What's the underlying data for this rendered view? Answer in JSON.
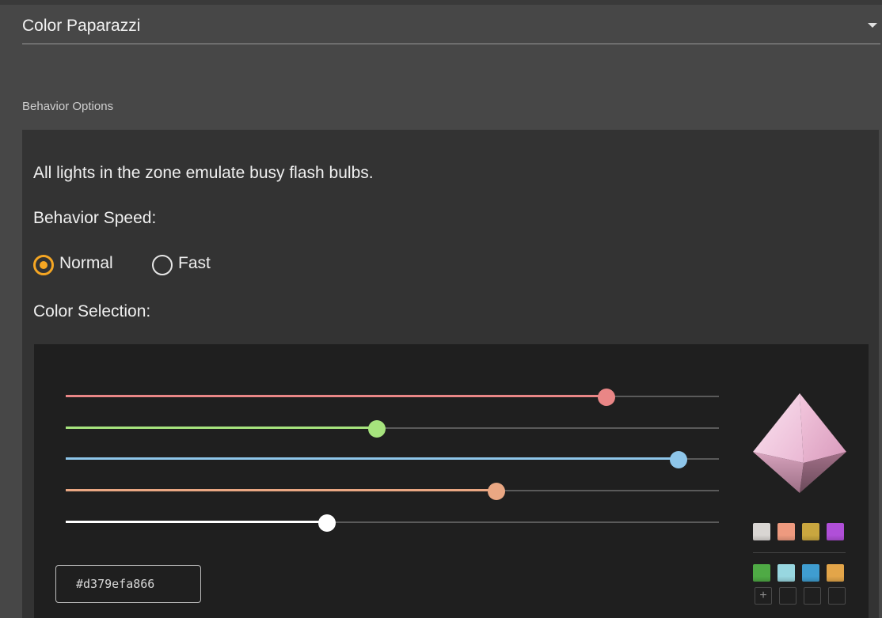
{
  "dropdown": {
    "value": "Color Paparazzi"
  },
  "section": {
    "label": "Behavior Options"
  },
  "panel": {
    "description": "All lights in the zone emulate busy flash bulbs.",
    "speed_label": "Behavior Speed:",
    "speed_options": [
      {
        "label": "Normal",
        "checked": true
      },
      {
        "label": "Fast",
        "checked": false
      }
    ],
    "color_label": "Color Selection:"
  },
  "picker": {
    "sliders": [
      {
        "name": "red",
        "fraction": 0.828,
        "fill_color": "#e98686",
        "thumb_color": "#e98686"
      },
      {
        "name": "green",
        "fraction": 0.476,
        "fill_color": "#a6e37d",
        "thumb_color": "#a6e37d"
      },
      {
        "name": "blue",
        "fraction": 0.938,
        "fill_color": "#8ec6ea",
        "thumb_color": "#8ec6ea"
      },
      {
        "name": "white-balance",
        "fraction": 0.659,
        "fill_color": "#eaa783",
        "thumb_color": "#eaa783"
      },
      {
        "name": "brightness",
        "fraction": 0.4,
        "fill_color": "#ffffff",
        "thumb_color": "#ffffff"
      }
    ],
    "hex_value": "#d379efa866",
    "swatches_row1": [
      "#d9d6d3",
      "#ee9a7f",
      "#c9a63f",
      "#b04fd8"
    ],
    "swatches_row2": [
      "#4faa45",
      "#98d7e0",
      "#3f9dd0",
      "#e3a549"
    ],
    "add_symbol": "+"
  }
}
